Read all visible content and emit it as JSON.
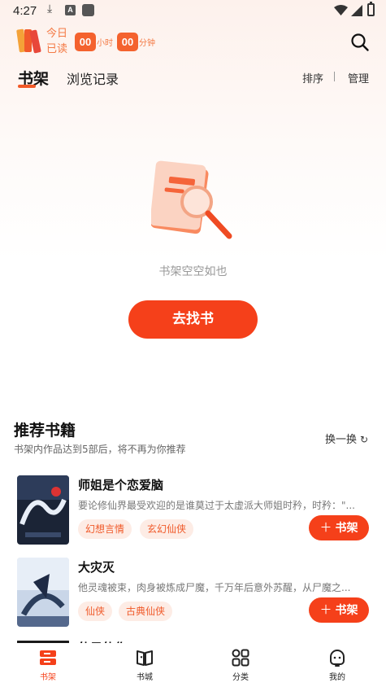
{
  "status_bar": {
    "time": "4:27"
  },
  "header": {
    "reading_label": "今日已读",
    "hours": "00",
    "hours_unit": "小时",
    "minutes": "00",
    "minutes_unit": "分钟"
  },
  "tabs": {
    "bookshelf": "书架",
    "history": "浏览记录",
    "sort": "排序",
    "manage": "管理"
  },
  "empty_state": {
    "message": "书架空空如也",
    "button": "去找书"
  },
  "recommend": {
    "title": "推荐书籍",
    "subtitle": "书架内作品达到5部后，将不再为你推荐",
    "refresh": "换一换",
    "add_label": "书架",
    "books": [
      {
        "title": "师姐是个恋爱脑",
        "desc": "要论修仙界最受欢迎的是谁莫过于太虚派大师姐时矜，时矜：\"...",
        "tags": [
          "幻想言情",
          "玄幻仙侠"
        ]
      },
      {
        "title": "大灾灭",
        "desc": "他灵魂被束，肉身被炼成尸魔，千万年后意外苏醒，从尸魔之...",
        "tags": [
          "仙侠",
          "古典仙侠"
        ]
      },
      {
        "title": "仙目仙作",
        "desc": "",
        "tags": []
      }
    ]
  },
  "bottom_nav": {
    "items": [
      "书架",
      "书城",
      "分类",
      "我的"
    ]
  },
  "colors": {
    "accent": "#f5401a",
    "accent_light": "#fdece5",
    "label_orange": "#f47a45"
  }
}
